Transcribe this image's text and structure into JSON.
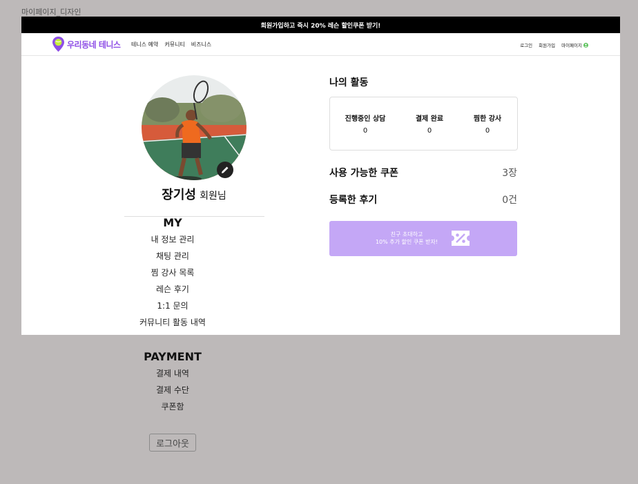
{
  "frame_title": "마이페이지_디자인",
  "promo_banner": "회원가입하고 즉시 20% 레슨 할인쿠폰 받기!",
  "brand": {
    "name": "우리동네 테니스",
    "accent": "#8e4ee6"
  },
  "nav": {
    "links": [
      "테니스 예약",
      "커뮤니티",
      "비즈니스"
    ],
    "right": {
      "login": "로그인",
      "signup": "회원가입",
      "mypage": "마이페이지"
    }
  },
  "profile": {
    "name": "장기성",
    "suffix": "회원님"
  },
  "menu_my": {
    "title": "MY",
    "items": [
      "내 정보 관리",
      "채팅 관리",
      "찜 강사 목록",
      "레슨 후기",
      "1:1 문의",
      "커뮤니티 활동 내역"
    ]
  },
  "menu_payment": {
    "title": "PAYMENT",
    "items": [
      "결제 내역",
      "결제 수단",
      "쿠폰함"
    ]
  },
  "logout_label": "로그아웃",
  "activity": {
    "title": "나의 활동",
    "stats": [
      {
        "label": "진행중인 상담",
        "value": "0"
      },
      {
        "label": "결제 완료",
        "value": "0"
      },
      {
        "label": "찜한 강사",
        "value": "0"
      }
    ]
  },
  "coupons": {
    "label": "사용 가능한 쿠폰",
    "value": "3장"
  },
  "reviews": {
    "label": "등록한 후기",
    "value": "0건"
  },
  "invite_banner": {
    "line1": "친구 초대하고",
    "line2": "10% 추가 할인 쿠폰 받자!",
    "color": "#c4a7f6"
  }
}
